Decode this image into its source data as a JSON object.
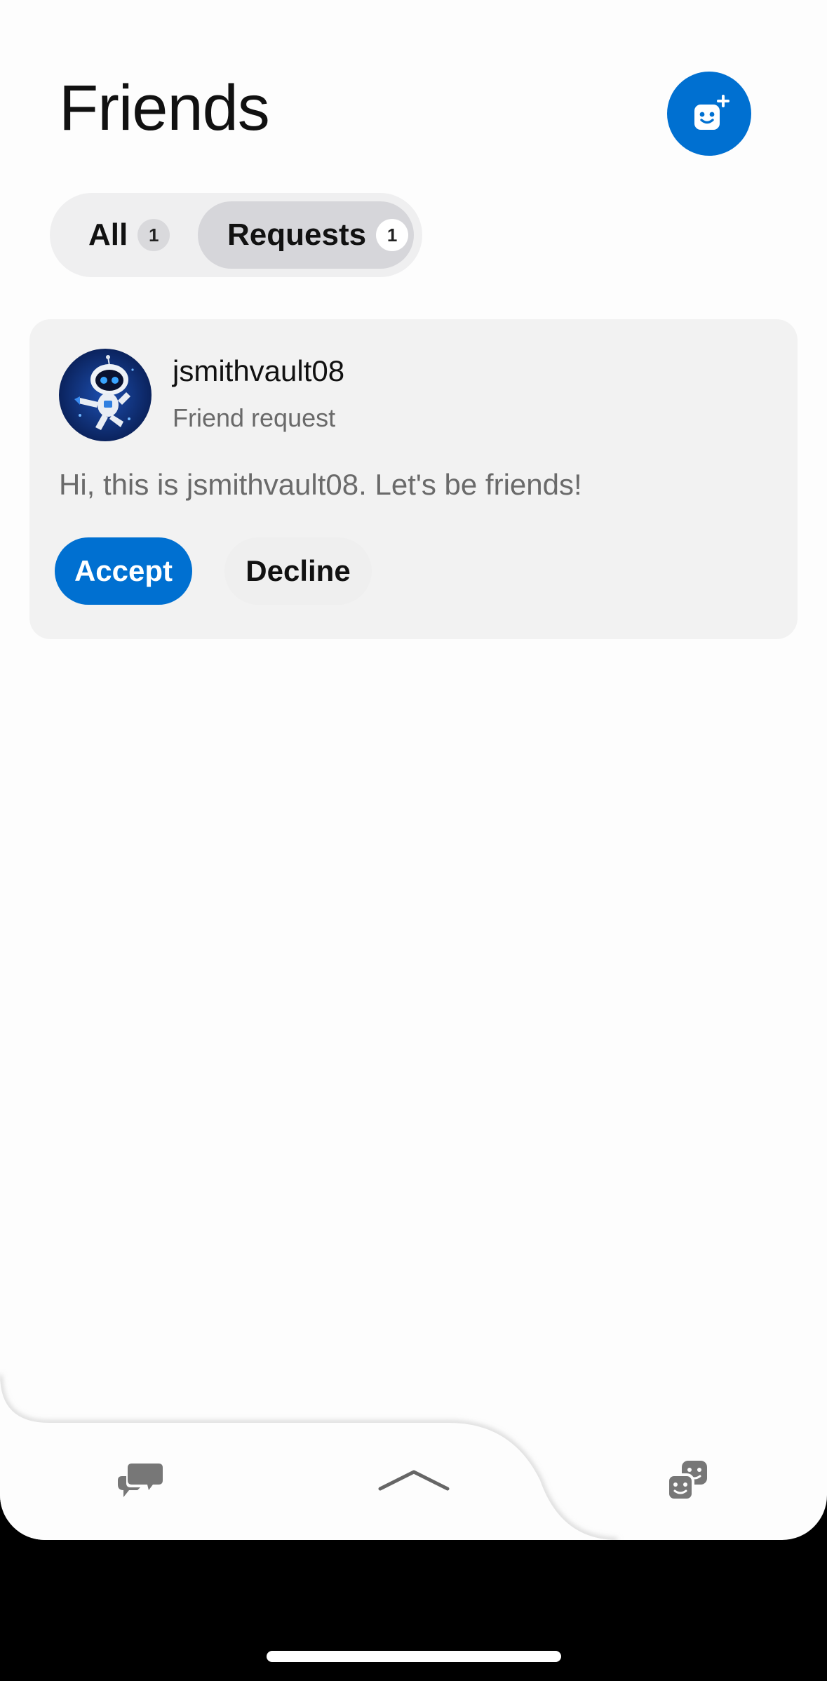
{
  "header": {
    "title": "Friends",
    "add_friend_icon": "add-friend-icon"
  },
  "tabs": [
    {
      "label": "All",
      "count": "1",
      "selected": false
    },
    {
      "label": "Requests",
      "count": "1",
      "selected": true
    }
  ],
  "request": {
    "username": "jsmithvault08",
    "subtitle": "Friend request",
    "message": "Hi, this is jsmithvault08. Let's be friends!",
    "avatar_icon": "astro-bot-avatar",
    "accept_label": "Accept",
    "decline_label": "Decline"
  },
  "bottom_nav": {
    "left_icon": "chat-bubbles-icon",
    "center_icon": "chevron-up-icon",
    "right_icon": "friends-faces-icon"
  },
  "colors": {
    "accent": "#0070d1",
    "card_bg": "#f2f2f2",
    "tab_selected_bg": "#d6d6da"
  }
}
